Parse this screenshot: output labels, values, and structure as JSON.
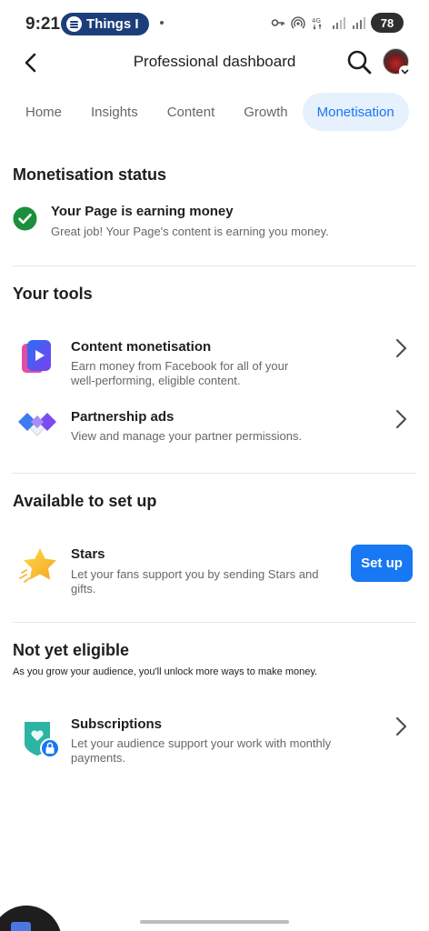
{
  "status_bar": {
    "time": "9:21",
    "media_pill": "Things I",
    "battery": "78"
  },
  "header": {
    "title": "Professional dashboard"
  },
  "tabs": [
    {
      "label": "Home"
    },
    {
      "label": "Insights"
    },
    {
      "label": "Content"
    },
    {
      "label": "Growth"
    },
    {
      "label": "Monetisation",
      "active": true
    }
  ],
  "monetisation_status": {
    "title": "Monetisation status",
    "item_title": "Your Page is earning money",
    "item_desc": "Great job! Your Page's content is earning you money."
  },
  "tools": {
    "title": "Your tools",
    "items": [
      {
        "title": "Content monetisation",
        "desc_line1": "Earn money from Facebook for all of your",
        "desc_line2": "well-performing, eligible content.",
        "icon": "play-video-icon"
      },
      {
        "title": "Partnership ads",
        "desc_line1": "View and manage your partner permissions.",
        "icon": "handshake-icon"
      }
    ]
  },
  "available": {
    "title": "Available to set up",
    "item_title": "Stars",
    "desc_line1": "Let your fans support you by sending Stars and",
    "desc_line2": "gifts.",
    "button": "Set up",
    "icon": "star-icon"
  },
  "not_eligible": {
    "title": "Not yet eligible",
    "caption": "As you grow your audience, you'll unlock more ways to make money.",
    "item_title": "Subscriptions",
    "desc_line1": "Let your audience support your work with monthly",
    "desc_line2": "payments.",
    "icon": "subscription-lock-icon"
  },
  "colors": {
    "accent": "#1877f2",
    "success": "#1a8f3c",
    "text_secondary": "#65676b"
  }
}
